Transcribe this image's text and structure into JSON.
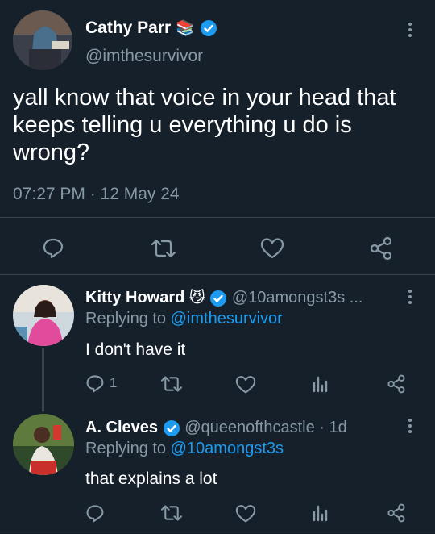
{
  "main_tweet": {
    "author_name": "Cathy Parr",
    "author_emoji": "📚",
    "author_handle": "@imthesurvivor",
    "text": "yall know that voice in your head that keeps telling u everything u do is wrong?",
    "timestamp": "07:27 PM · 12 May 24"
  },
  "replies": [
    {
      "author_name": "Kitty Howard",
      "author_emoji": "😼",
      "author_handle": "@10amongst3s ...",
      "replying_prefix": "Replying to",
      "replying_to": "@imthesurvivor",
      "text": "I don't have it",
      "reply_count": "1"
    },
    {
      "author_name": "A. Cleves",
      "author_handle": "@queenofthcastle",
      "age": "· 1d",
      "replying_prefix": "Replying to",
      "replying_to": "@10amongst3s",
      "text": "that explains a lot"
    }
  ],
  "colors": {
    "background": "#15202b",
    "muted": "#8899a6",
    "link": "#1d9bf0",
    "divider": "#38444d"
  },
  "icons": [
    "reply-icon",
    "retweet-icon",
    "like-icon",
    "share-icon",
    "analytics-icon",
    "verified-badge-icon",
    "more-icon"
  ]
}
